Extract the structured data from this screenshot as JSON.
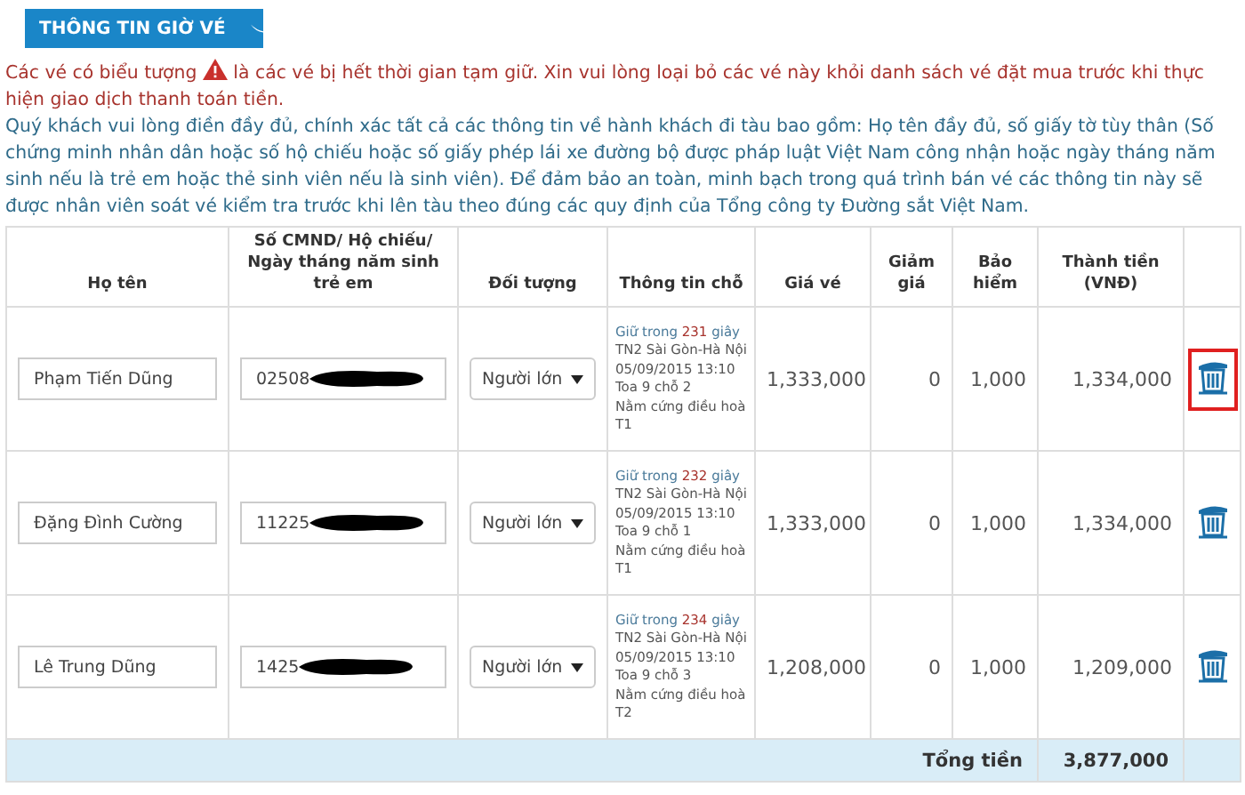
{
  "section_title": "THÔNG TIN GIỜ VÉ",
  "warning": {
    "before": "Các vé có biểu tượng",
    "after": "là các vé bị hết thời gian tạm giữ. Xin vui lòng loại bỏ các vé này khỏi danh sách vé đặt mua trước khi thực hiện giao dịch thanh toán tiền."
  },
  "instructions": "Quý khách vui lòng điền đầy đủ, chính xác tất cả các thông tin về hành khách đi tàu bao gồm: Họ tên đầy đủ, số giấy tờ tùy thân (Số chứng minh nhân dân hoặc số hộ chiếu hoặc số giấy phép lái xe đường bộ được pháp luật Việt Nam công nhận hoặc ngày tháng năm sinh nếu là trẻ em hoặc thẻ sinh viên nếu là sinh viên). Để đảm bảo an toàn, minh bạch trong quá trình bán vé các thông tin này sẽ được nhân viên soát vé kiểm tra trước khi lên tàu theo đúng các quy định của Tổng công ty Đường sắt Việt Nam.",
  "table": {
    "columns": [
      "Họ tên",
      "Số CMND/ Hộ chiếu/ Ngày tháng năm sinh trẻ em",
      "Đối tượng",
      "Thông tin chỗ",
      "Giá vé",
      "Giảm giá",
      "Bảo hiểm",
      "Thành tiền (VNĐ)"
    ],
    "rows": [
      {
        "name": "Phạm Tiến Dũng",
        "id_number": "02508",
        "passenger_type": "Người lớn",
        "hold_prefix": "Giữ trong",
        "hold_seconds": "231",
        "hold_suffix": "giây",
        "seat_lines": [
          "TN2 Sài Gòn-Hà Nội",
          "05/09/2015 13:10",
          "Toa 9 chỗ 2",
          "Nằm cứng điều hoà T1"
        ],
        "price": "1,333,000",
        "discount": "0",
        "insurance": "1,000",
        "total": "1,334,000",
        "highlighted": true
      },
      {
        "name": "Đặng Đình Cường",
        "id_number": "11225",
        "passenger_type": "Người lớn",
        "hold_prefix": "Giữ trong",
        "hold_seconds": "232",
        "hold_suffix": "giây",
        "seat_lines": [
          "TN2 Sài Gòn-Hà Nội",
          "05/09/2015 13:10",
          "Toa 9 chỗ 1",
          "Nằm cứng điều hoà T1"
        ],
        "price": "1,333,000",
        "discount": "0",
        "insurance": "1,000",
        "total": "1,334,000",
        "highlighted": false
      },
      {
        "name": "Lê Trung Dũng",
        "id_number": "1425",
        "passenger_type": "Người lớn",
        "hold_prefix": "Giữ trong",
        "hold_seconds": "234",
        "hold_suffix": "giây",
        "seat_lines": [
          "TN2 Sài Gòn-Hà Nội",
          "05/09/2015 13:10",
          "Toa 9 chỗ 3",
          "Nằm cứng điều hoà T2"
        ],
        "price": "1,208,000",
        "discount": "0",
        "insurance": "1,000",
        "total": "1,209,000",
        "highlighted": false
      }
    ],
    "footer": {
      "label": "Tổng tiền",
      "value": "3,877,000"
    }
  }
}
